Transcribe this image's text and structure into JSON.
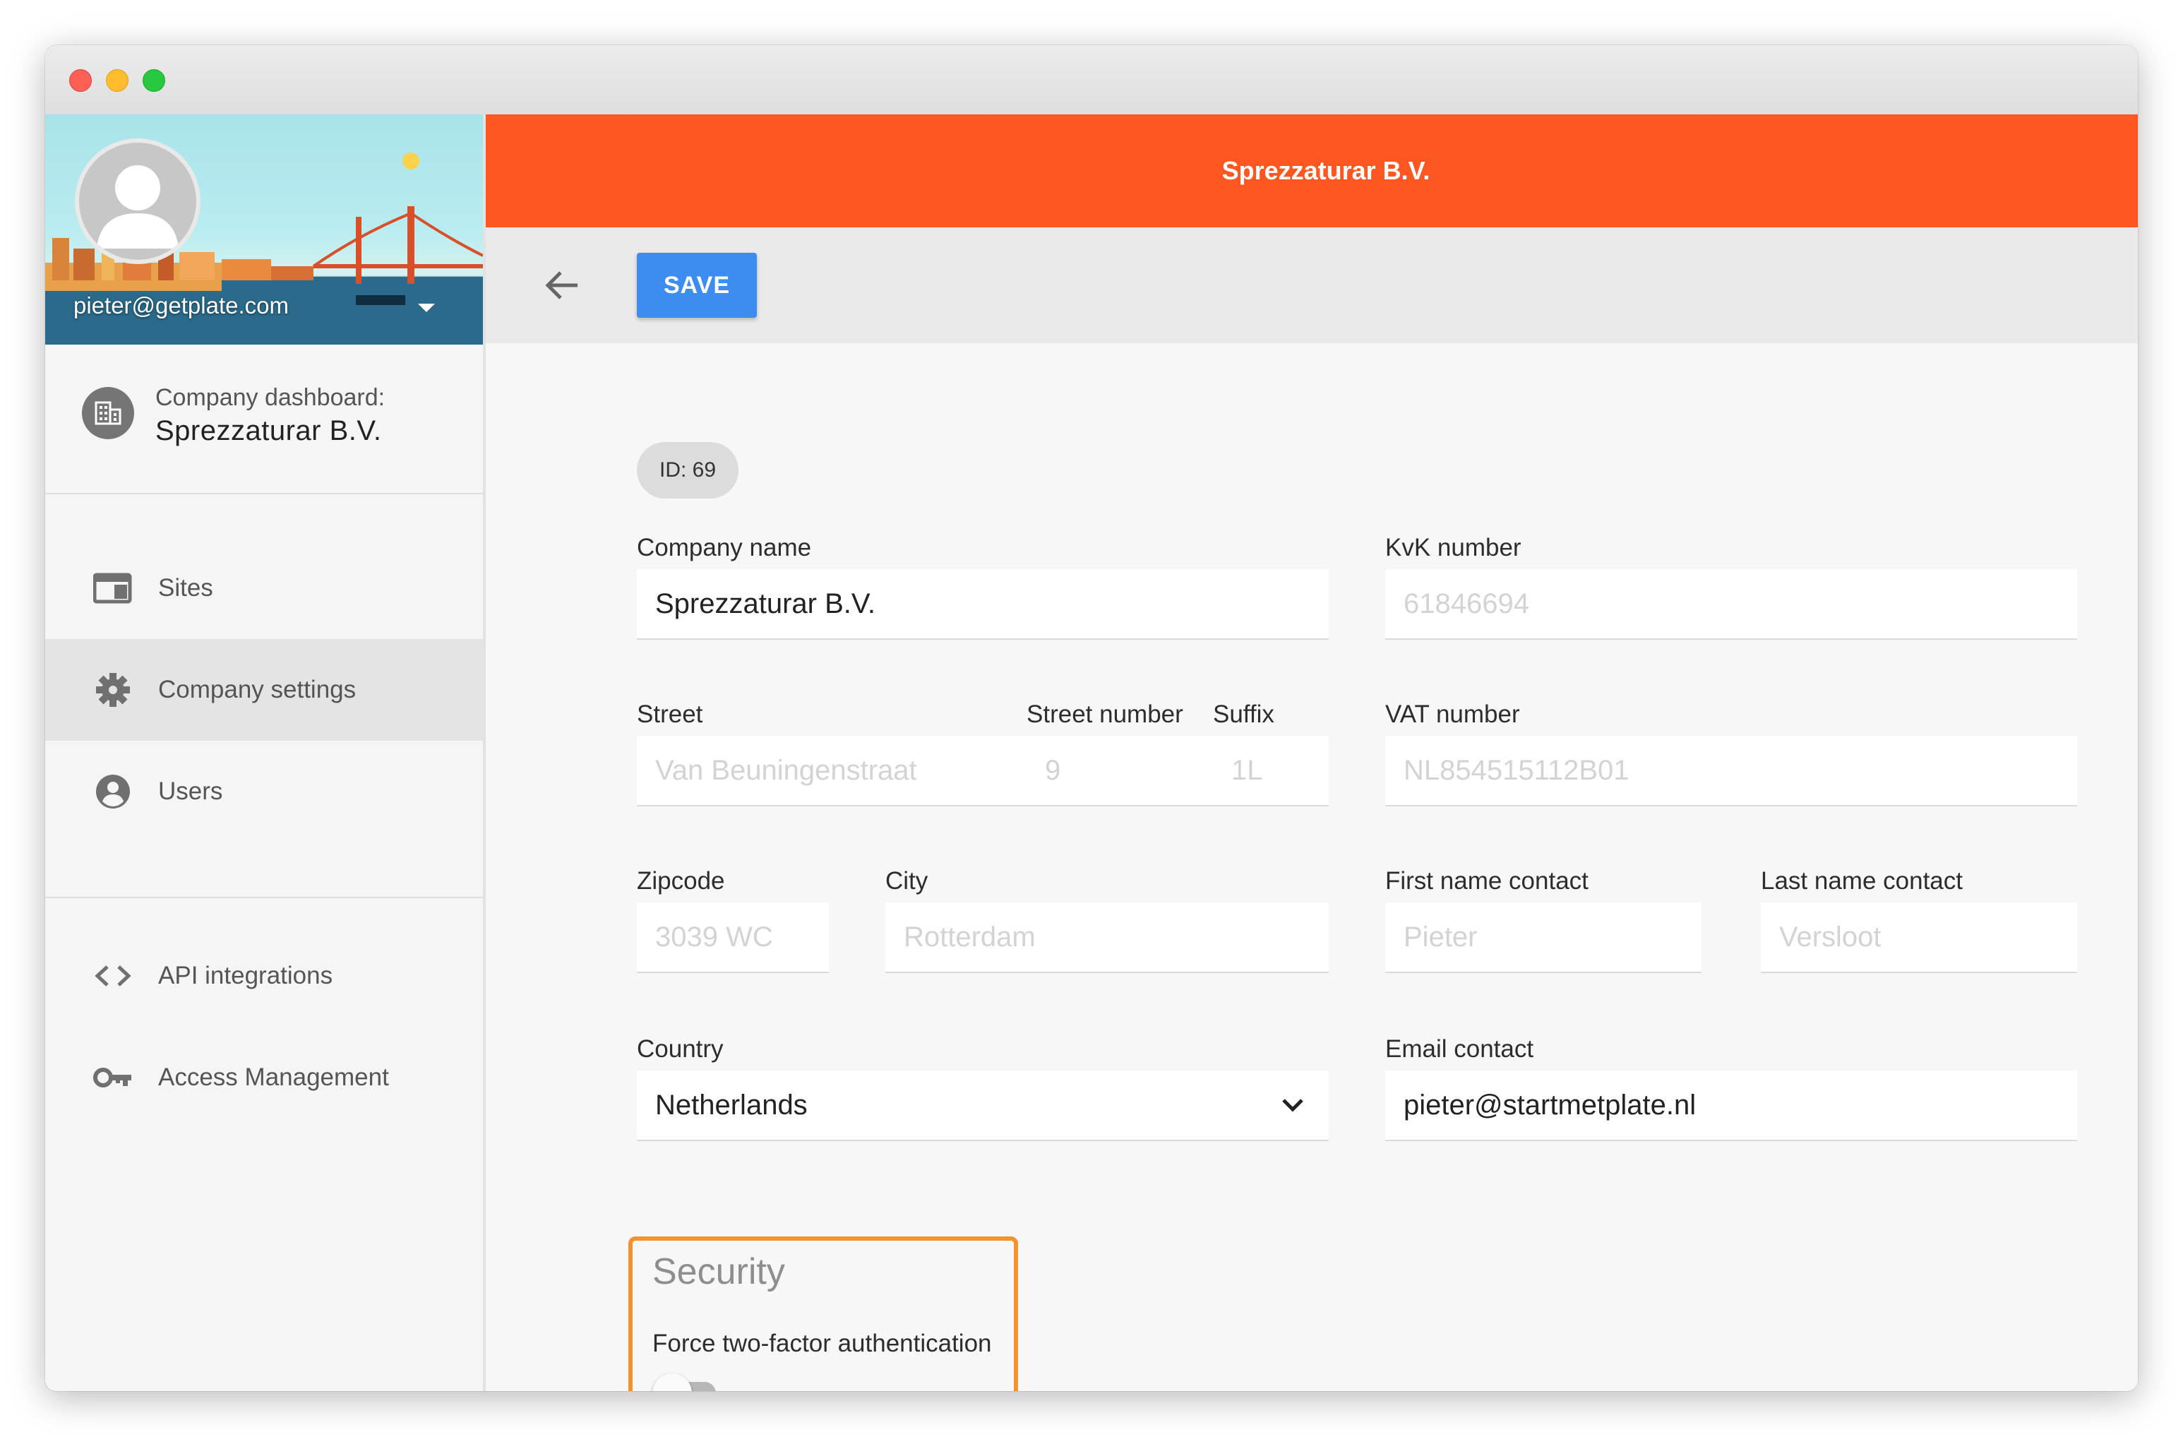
{
  "profile": {
    "email": "pieter@getplate.com"
  },
  "company": {
    "dashboard_label": "Company dashboard:",
    "name": "Sprezzaturar B.V."
  },
  "sidebar": {
    "items": [
      {
        "label": "Sites",
        "icon": "browser-window-icon"
      },
      {
        "label": "Company settings",
        "icon": "gear-icon",
        "active": true
      },
      {
        "label": "Users",
        "icon": "user-circle-icon"
      },
      {
        "label": "API integrations",
        "icon": "code-brackets-icon"
      },
      {
        "label": "Access Management",
        "icon": "key-icon"
      }
    ]
  },
  "header": {
    "title": "Sprezzaturar B.V.",
    "color": "#ff5722"
  },
  "toolbar": {
    "save_label": "SAVE"
  },
  "form": {
    "id_label": "ID: 69",
    "company_name": {
      "label": "Company name",
      "value": "Sprezzaturar B.V."
    },
    "kvk_number": {
      "label": "KvK number",
      "placeholder": "61846694"
    },
    "street": {
      "label": "Street",
      "placeholder": "Van Beuningenstraat"
    },
    "street_number": {
      "label": "Street number",
      "placeholder": "9"
    },
    "suffix": {
      "label": "Suffix",
      "placeholder": "1L"
    },
    "vat_number": {
      "label": "VAT number",
      "placeholder": "NL854515112B01"
    },
    "zipcode": {
      "label": "Zipcode",
      "placeholder": "3039 WC"
    },
    "city": {
      "label": "City",
      "placeholder": "Rotterdam"
    },
    "first_name_contact": {
      "label": "First name contact",
      "placeholder": "Pieter"
    },
    "last_name_contact": {
      "label": "Last name contact",
      "placeholder": "Versloot"
    },
    "country": {
      "label": "Country",
      "value": "Netherlands"
    },
    "email_contact": {
      "label": "Email contact",
      "value": "pieter@startmetplate.nl"
    }
  },
  "security": {
    "title": "Security",
    "tfa_label": "Force two-factor authentication",
    "tfa_enabled": false,
    "highlight_color": "#f4922c"
  },
  "colors": {
    "accent_button": "#3d8cf0"
  }
}
